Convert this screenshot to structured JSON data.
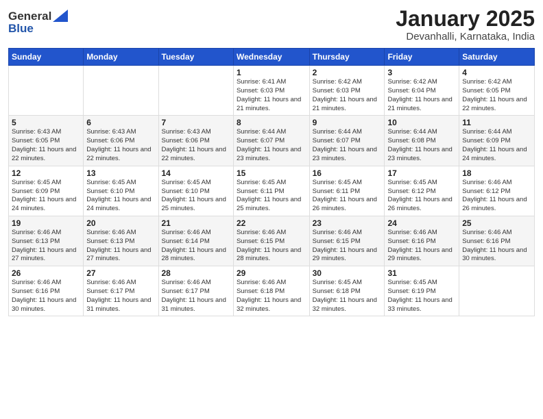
{
  "header": {
    "logo_line1": "General",
    "logo_line2": "Blue",
    "month": "January 2025",
    "location": "Devanhalli, Karnataka, India"
  },
  "weekdays": [
    "Sunday",
    "Monday",
    "Tuesday",
    "Wednesday",
    "Thursday",
    "Friday",
    "Saturday"
  ],
  "weeks": [
    [
      {
        "day": "",
        "info": ""
      },
      {
        "day": "",
        "info": ""
      },
      {
        "day": "",
        "info": ""
      },
      {
        "day": "1",
        "info": "Sunrise: 6:41 AM\nSunset: 6:03 PM\nDaylight: 11 hours and 21 minutes."
      },
      {
        "day": "2",
        "info": "Sunrise: 6:42 AM\nSunset: 6:03 PM\nDaylight: 11 hours and 21 minutes."
      },
      {
        "day": "3",
        "info": "Sunrise: 6:42 AM\nSunset: 6:04 PM\nDaylight: 11 hours and 21 minutes."
      },
      {
        "day": "4",
        "info": "Sunrise: 6:42 AM\nSunset: 6:05 PM\nDaylight: 11 hours and 22 minutes."
      }
    ],
    [
      {
        "day": "5",
        "info": "Sunrise: 6:43 AM\nSunset: 6:05 PM\nDaylight: 11 hours and 22 minutes."
      },
      {
        "day": "6",
        "info": "Sunrise: 6:43 AM\nSunset: 6:06 PM\nDaylight: 11 hours and 22 minutes."
      },
      {
        "day": "7",
        "info": "Sunrise: 6:43 AM\nSunset: 6:06 PM\nDaylight: 11 hours and 22 minutes."
      },
      {
        "day": "8",
        "info": "Sunrise: 6:44 AM\nSunset: 6:07 PM\nDaylight: 11 hours and 23 minutes."
      },
      {
        "day": "9",
        "info": "Sunrise: 6:44 AM\nSunset: 6:07 PM\nDaylight: 11 hours and 23 minutes."
      },
      {
        "day": "10",
        "info": "Sunrise: 6:44 AM\nSunset: 6:08 PM\nDaylight: 11 hours and 23 minutes."
      },
      {
        "day": "11",
        "info": "Sunrise: 6:44 AM\nSunset: 6:09 PM\nDaylight: 11 hours and 24 minutes."
      }
    ],
    [
      {
        "day": "12",
        "info": "Sunrise: 6:45 AM\nSunset: 6:09 PM\nDaylight: 11 hours and 24 minutes."
      },
      {
        "day": "13",
        "info": "Sunrise: 6:45 AM\nSunset: 6:10 PM\nDaylight: 11 hours and 24 minutes."
      },
      {
        "day": "14",
        "info": "Sunrise: 6:45 AM\nSunset: 6:10 PM\nDaylight: 11 hours and 25 minutes."
      },
      {
        "day": "15",
        "info": "Sunrise: 6:45 AM\nSunset: 6:11 PM\nDaylight: 11 hours and 25 minutes."
      },
      {
        "day": "16",
        "info": "Sunrise: 6:45 AM\nSunset: 6:11 PM\nDaylight: 11 hours and 26 minutes."
      },
      {
        "day": "17",
        "info": "Sunrise: 6:45 AM\nSunset: 6:12 PM\nDaylight: 11 hours and 26 minutes."
      },
      {
        "day": "18",
        "info": "Sunrise: 6:46 AM\nSunset: 6:12 PM\nDaylight: 11 hours and 26 minutes."
      }
    ],
    [
      {
        "day": "19",
        "info": "Sunrise: 6:46 AM\nSunset: 6:13 PM\nDaylight: 11 hours and 27 minutes."
      },
      {
        "day": "20",
        "info": "Sunrise: 6:46 AM\nSunset: 6:13 PM\nDaylight: 11 hours and 27 minutes."
      },
      {
        "day": "21",
        "info": "Sunrise: 6:46 AM\nSunset: 6:14 PM\nDaylight: 11 hours and 28 minutes."
      },
      {
        "day": "22",
        "info": "Sunrise: 6:46 AM\nSunset: 6:15 PM\nDaylight: 11 hours and 28 minutes."
      },
      {
        "day": "23",
        "info": "Sunrise: 6:46 AM\nSunset: 6:15 PM\nDaylight: 11 hours and 29 minutes."
      },
      {
        "day": "24",
        "info": "Sunrise: 6:46 AM\nSunset: 6:16 PM\nDaylight: 11 hours and 29 minutes."
      },
      {
        "day": "25",
        "info": "Sunrise: 6:46 AM\nSunset: 6:16 PM\nDaylight: 11 hours and 30 minutes."
      }
    ],
    [
      {
        "day": "26",
        "info": "Sunrise: 6:46 AM\nSunset: 6:16 PM\nDaylight: 11 hours and 30 minutes."
      },
      {
        "day": "27",
        "info": "Sunrise: 6:46 AM\nSunset: 6:17 PM\nDaylight: 11 hours and 31 minutes."
      },
      {
        "day": "28",
        "info": "Sunrise: 6:46 AM\nSunset: 6:17 PM\nDaylight: 11 hours and 31 minutes."
      },
      {
        "day": "29",
        "info": "Sunrise: 6:46 AM\nSunset: 6:18 PM\nDaylight: 11 hours and 32 minutes."
      },
      {
        "day": "30",
        "info": "Sunrise: 6:45 AM\nSunset: 6:18 PM\nDaylight: 11 hours and 32 minutes."
      },
      {
        "day": "31",
        "info": "Sunrise: 6:45 AM\nSunset: 6:19 PM\nDaylight: 11 hours and 33 minutes."
      },
      {
        "day": "",
        "info": ""
      }
    ]
  ]
}
